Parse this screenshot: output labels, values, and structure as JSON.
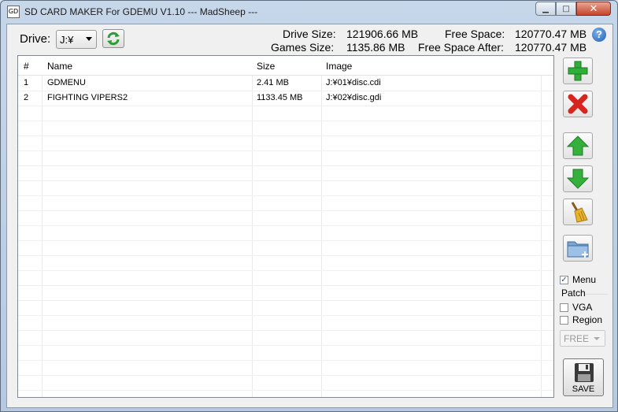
{
  "window": {
    "title": "SD CARD MAKER For GDEMU  V1.10 ---  MadSheep ---",
    "app_icon_text": "GD",
    "minimize_symbol": "▁",
    "maximize_symbol": "□",
    "close_symbol": "✕"
  },
  "drive": {
    "label": "Drive:",
    "selected": "J:¥"
  },
  "stats": {
    "drive_size_label": "Drive Size:",
    "drive_size_value": "121906.66 MB",
    "games_size_label": "Games Size:",
    "games_size_value": "1135.86 MB",
    "free_space_label": "Free Space:",
    "free_space_value": "120770.47 MB",
    "free_after_label": "Free Space After:",
    "free_after_value": "120770.47 MB"
  },
  "help_symbol": "?",
  "table": {
    "columns": [
      "#",
      "Name",
      "Size",
      "Image"
    ],
    "rows": [
      {
        "num": "1",
        "name": "GDMENU",
        "size": "2.41 MB",
        "image": "J:¥01¥disc.cdi"
      },
      {
        "num": "2",
        "name": "FIGHTING VIPERS2",
        "size": "1133.45 MB",
        "image": "J:¥02¥disc.gdi"
      }
    ]
  },
  "options": {
    "menu_label": "Menu",
    "menu_checked": true,
    "patch_label": "Patch",
    "vga_label": "VGA",
    "vga_checked": false,
    "region_label": "Region",
    "region_checked": false,
    "region_select_value": "FREE"
  },
  "save_label": "SAVE",
  "colors": {
    "add_green": "#2fae3a",
    "delete_red": "#d7261e",
    "arrow_green": "#36b03c",
    "folder_blue": "#7aa6d6"
  }
}
